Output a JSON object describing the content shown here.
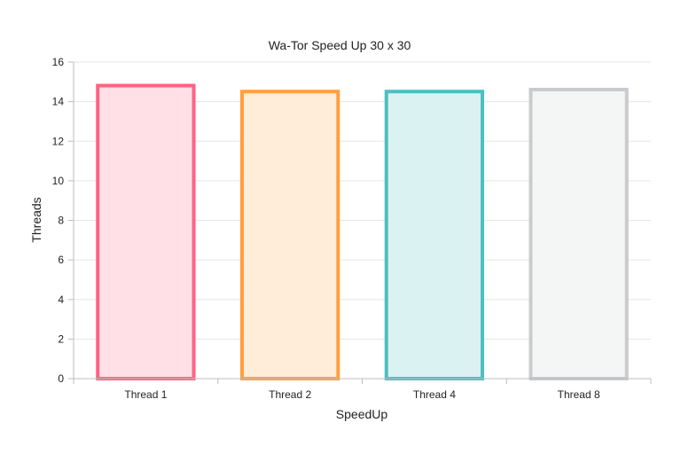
{
  "chart_data": {
    "type": "bar",
    "title": "Wa-Tor Speed Up 30 x 30",
    "xlabel": "SpeedUp",
    "ylabel": "Threads",
    "categories": [
      "Thread 1",
      "Thread 2",
      "Thread 4",
      "Thread 8"
    ],
    "values": [
      14.9,
      14.6,
      14.6,
      14.7
    ],
    "ylim": [
      0,
      16
    ],
    "yticks": [
      0,
      2,
      4,
      6,
      8,
      10,
      12,
      14,
      16
    ],
    "grid": true,
    "legend": "none",
    "colors": {
      "stroke": [
        "#ff6384",
        "#ff9f40",
        "#4bc0c0",
        "#c9cbcf"
      ],
      "fill": [
        "#ffe0e6",
        "#ffecd9",
        "#dbf2f2",
        "#f4f5f5"
      ]
    }
  }
}
